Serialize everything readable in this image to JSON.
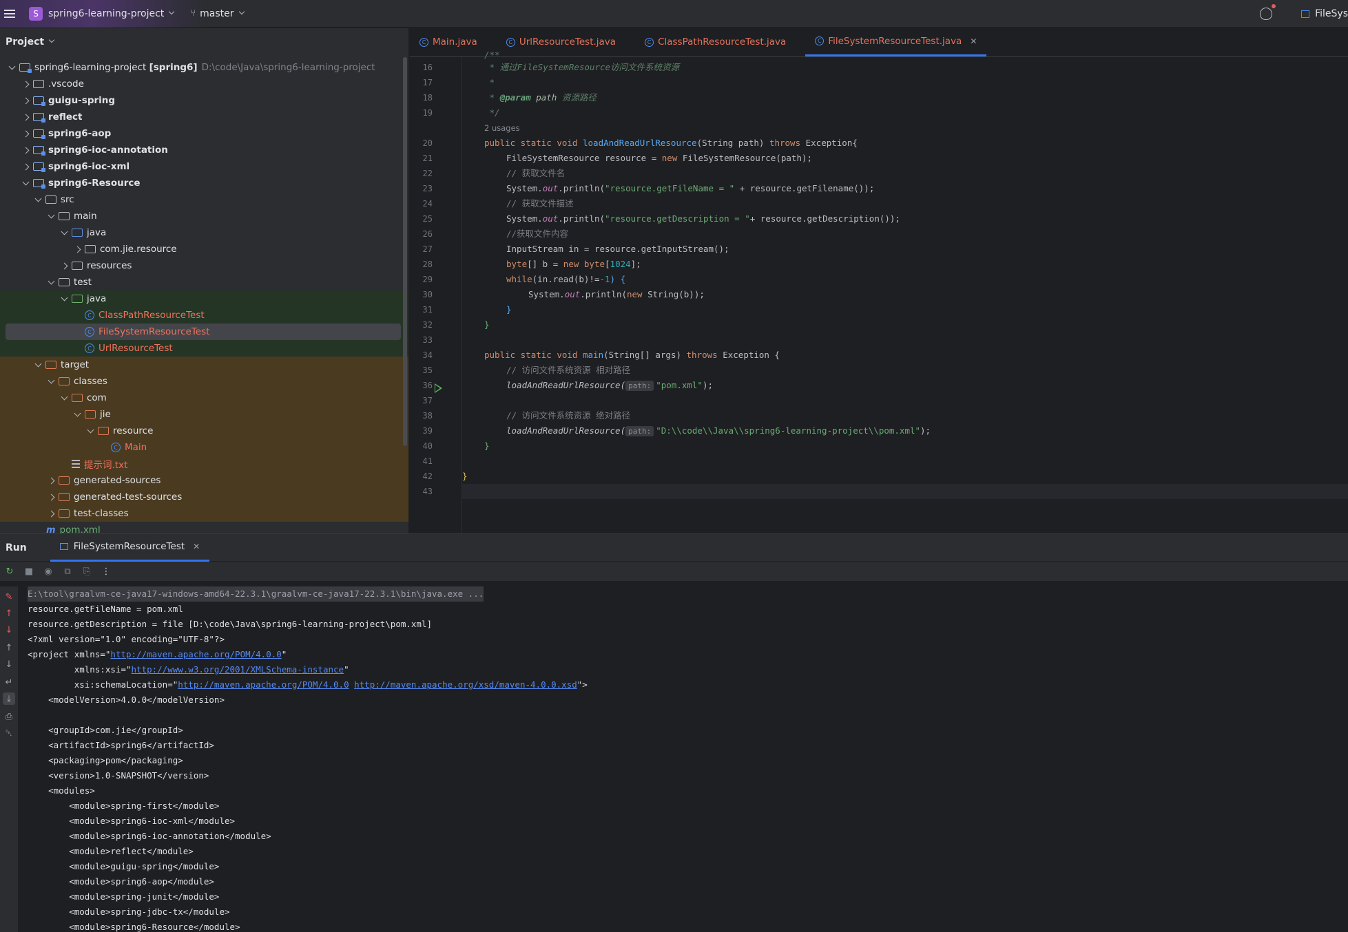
{
  "titlebar": {
    "project_badge": "S",
    "project_name": "spring6-learning-project",
    "branch": "master",
    "run_config": "FileSys"
  },
  "project_panel": {
    "title": "Project",
    "tree": [
      {
        "label": "spring6-learning-project",
        "suffix": "[spring6]",
        "path": "D:\\code\\Java\\spring6-learning-project"
      },
      {
        "label": ".vscode"
      },
      {
        "label": "guigu-spring"
      },
      {
        "label": "reflect"
      },
      {
        "label": "spring6-aop"
      },
      {
        "label": "spring6-ioc-annotation"
      },
      {
        "label": "spring6-ioc-xml"
      },
      {
        "label": "spring6-Resource"
      },
      {
        "label": "src"
      },
      {
        "label": "main"
      },
      {
        "label": "java"
      },
      {
        "label": "com.jie.resource"
      },
      {
        "label": "resources"
      },
      {
        "label": "test"
      },
      {
        "label": "java"
      },
      {
        "label": "ClassPathResourceTest"
      },
      {
        "label": "FileSystemResourceTest"
      },
      {
        "label": "UrlResourceTest"
      },
      {
        "label": "target"
      },
      {
        "label": "classes"
      },
      {
        "label": "com"
      },
      {
        "label": "jie"
      },
      {
        "label": "resource"
      },
      {
        "label": "Main"
      },
      {
        "label": "提示词.txt"
      },
      {
        "label": "generated-sources"
      },
      {
        "label": "generated-test-sources"
      },
      {
        "label": "test-classes"
      },
      {
        "label": "pom.xml"
      }
    ]
  },
  "editor": {
    "tabs": [
      {
        "label": "Main.java"
      },
      {
        "label": "UrlResourceTest.java"
      },
      {
        "label": "ClassPathResourceTest.java"
      },
      {
        "label": "FileSystemResourceTest.java",
        "active": true
      }
    ],
    "line_numbers": [
      "16",
      "17",
      "18",
      "19",
      "20",
      "21",
      "22",
      "23",
      "24",
      "25",
      "26",
      "27",
      "28",
      "29",
      "30",
      "31",
      "32",
      "33",
      "34",
      "35",
      "36",
      "37",
      "38",
      "39",
      "40",
      "41",
      "42",
      "43"
    ],
    "usages_hint": "2 usages",
    "param_hint": "path:",
    "code": {
      "l15": "/**",
      "l16a": " * 通过",
      "l16b": "FileSystemResource",
      "l16c": "访问文件系统资源",
      "l17": " *",
      "l18a": " * ",
      "l18b": "@param",
      "l18c": " path ",
      "l18d": "资源路径",
      "l19": " */",
      "l20_kw": "public static void ",
      "l20_fn": "loadAndReadUrlResource",
      "l20_rest": "(String path) ",
      "l20_kw2": "throws",
      "l20_end": " Exception{",
      "l21a": "FileSystemResource resource = ",
      "l21b": "new",
      "l21c": " FileSystemResource(path);",
      "l22": "// 获取文件名",
      "l23a": "System.",
      "l23b": "out",
      "l23c": ".println(",
      "l23d": "\"resource.getFileName = \"",
      "l23e": " + resource.getFilename());",
      "l24": "// 获取文件描述",
      "l25d": "\"resource.getDescription = \"",
      "l25e": "+ resource.getDescription());",
      "l26": "//获取文件内容",
      "l27": "InputStream in = resource.getInputStream();",
      "l28a": "byte",
      "l28b": "[] b = ",
      "l28c": "new",
      "l28d": " byte",
      "l28e": "[",
      "l28f": "1024",
      "l28g": "];",
      "l29a": "while",
      "l29b": "(in.read(b)!=",
      "l29c": "-1",
      "l29d": ") {",
      "l30a": "System.",
      "l30b": "out",
      "l30c": ".println(",
      "l30d": "new",
      "l30e": " String(b));",
      "l31": "}",
      "l32": "}",
      "l34_kw": "public static void ",
      "l34_fn": "main",
      "l34_rest": "(String[] args) ",
      "l34_kw2": "throws",
      "l34_end": " Exception {",
      "l35": "// 访问文件系统资源 相对路径",
      "l36a": "loadAndReadUrlResource(",
      "l36b": "\"pom.xml\"",
      "l36c": ");",
      "l38": "// 访问文件系统资源 绝对路径",
      "l39a": "loadAndReadUrlResource(",
      "l39b": "\"D:\\\\code\\\\Java\\\\spring6-learning-project\\\\pom.xml\"",
      "l39c": ");",
      "l40": "}",
      "l42": "}"
    }
  },
  "run_panel": {
    "title": "Run",
    "tab": "FileSystemResourceTest",
    "console": {
      "cmd": "E:\\tool\\graalvm-ce-java17-windows-amd64-22.3.1\\graalvm-ce-java17-22.3.1\\bin\\java.exe ...",
      "o1": "resource.getFileName = pom.xml",
      "o2": "resource.getDescription = file [D:\\code\\Java\\spring6-learning-project\\pom.xml]",
      "o3": "<?xml version=\"1.0\" encoding=\"UTF-8\"?>",
      "o4a": "<project xmlns=\"",
      "o4b": "http://maven.apache.org/POM/4.0.0",
      "o4c": "\"",
      "o5a": "         xmlns:xsi=\"",
      "o5b": "http://www.w3.org/2001/XMLSchema-instance",
      "o5c": "\"",
      "o6a": "         xsi:schemaLocation=\"",
      "o6b": "http://maven.apache.org/POM/4.0.0",
      "o6c": " ",
      "o6d": "http://maven.apache.org/xsd/maven-4.0.0.xsd",
      "o6e": "\">",
      "o7": "    <modelVersion>4.0.0</modelVersion>",
      "o8": "",
      "o9": "    <groupId>com.jie</groupId>",
      "o10": "    <artifactId>spring6</artifactId>",
      "o11": "    <packaging>pom</packaging>",
      "o12": "    <version>1.0-SNAPSHOT</version>",
      "o13": "    <modules>",
      "o14": "        <module>spring-first</module>",
      "o15": "        <module>spring6-ioc-xml</module>",
      "o16": "        <module>spring6-ioc-annotation</module>",
      "o17": "        <module>reflect</module>",
      "o18": "        <module>guigu-spring</module>",
      "o19": "        <module>spring6-aop</module>",
      "o20": "        <module>spring-junit</module>",
      "o21": "        <module>spring-jdbc-tx</module>",
      "o22": "        <module>spring6-Resource</module>"
    }
  }
}
